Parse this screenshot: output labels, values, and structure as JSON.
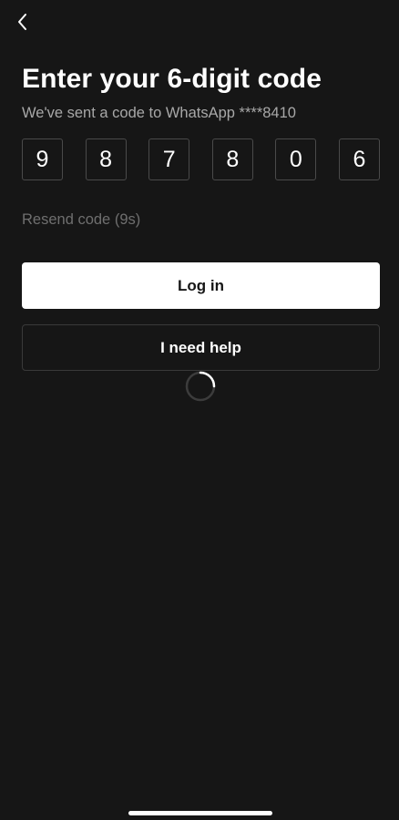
{
  "header": {
    "back_icon": "chevron-left-icon"
  },
  "main": {
    "title": "Enter your 6-digit code",
    "subtitle": "We've sent a code to WhatsApp ****8410",
    "code_digits": [
      "9",
      "8",
      "7",
      "8",
      "0",
      "6"
    ],
    "resend_label": "Resend code (9s)",
    "login_label": "Log in",
    "help_label": "I need help",
    "loading_icon": "spinner-icon"
  },
  "colors": {
    "background": "#161616",
    "primary_button": "#ffffff",
    "muted_text": "#a8a8a8",
    "disabled_text": "#6f6f6f"
  }
}
